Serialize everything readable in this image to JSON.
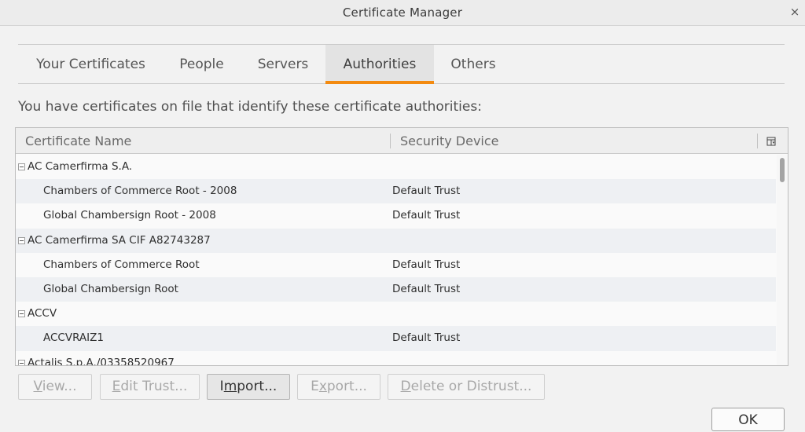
{
  "window": {
    "title": "Certificate Manager",
    "close_glyph": "×"
  },
  "tabs": [
    {
      "label": "Your Certificates",
      "active": false
    },
    {
      "label": "People",
      "active": false
    },
    {
      "label": "Servers",
      "active": false
    },
    {
      "label": "Authorities",
      "active": true
    },
    {
      "label": "Others",
      "active": false
    }
  ],
  "description": "You have certificates on file that identify these certificate authorities:",
  "tree": {
    "columns": [
      "Certificate Name",
      "Security Device"
    ],
    "column_picker_icon": "column-picker-icon",
    "rows": [
      {
        "type": "group",
        "name": "AC Camerfirma S.A.",
        "device": ""
      },
      {
        "type": "cert",
        "name": "Chambers of Commerce Root - 2008",
        "device": "Default Trust"
      },
      {
        "type": "cert",
        "name": "Global Chambersign Root - 2008",
        "device": "Default Trust"
      },
      {
        "type": "group",
        "name": "AC Camerfirma SA CIF A82743287",
        "device": ""
      },
      {
        "type": "cert",
        "name": "Chambers of Commerce Root",
        "device": "Default Trust"
      },
      {
        "type": "cert",
        "name": "Global Chambersign Root",
        "device": "Default Trust"
      },
      {
        "type": "group",
        "name": "ACCV",
        "device": ""
      },
      {
        "type": "cert",
        "name": "ACCVRAIZ1",
        "device": "Default Trust"
      },
      {
        "type": "group",
        "name": "Actalis S.p.A./03358520967",
        "device": ""
      }
    ]
  },
  "buttons": {
    "view": {
      "pre": "",
      "key": "V",
      "post": "iew...",
      "enabled": false
    },
    "edit_trust": {
      "pre": "",
      "key": "E",
      "post": "dit Trust...",
      "enabled": false
    },
    "import": {
      "pre": "I",
      "key": "m",
      "post": "port...",
      "enabled": true
    },
    "export": {
      "pre": "E",
      "key": "x",
      "post": "port...",
      "enabled": false
    },
    "delete": {
      "pre": "",
      "key": "D",
      "post": "elete or Distrust...",
      "enabled": false
    },
    "ok": "OK"
  },
  "colors": {
    "active_tab_accent": "#f38a10",
    "row_stripe": "#eef0f3"
  }
}
